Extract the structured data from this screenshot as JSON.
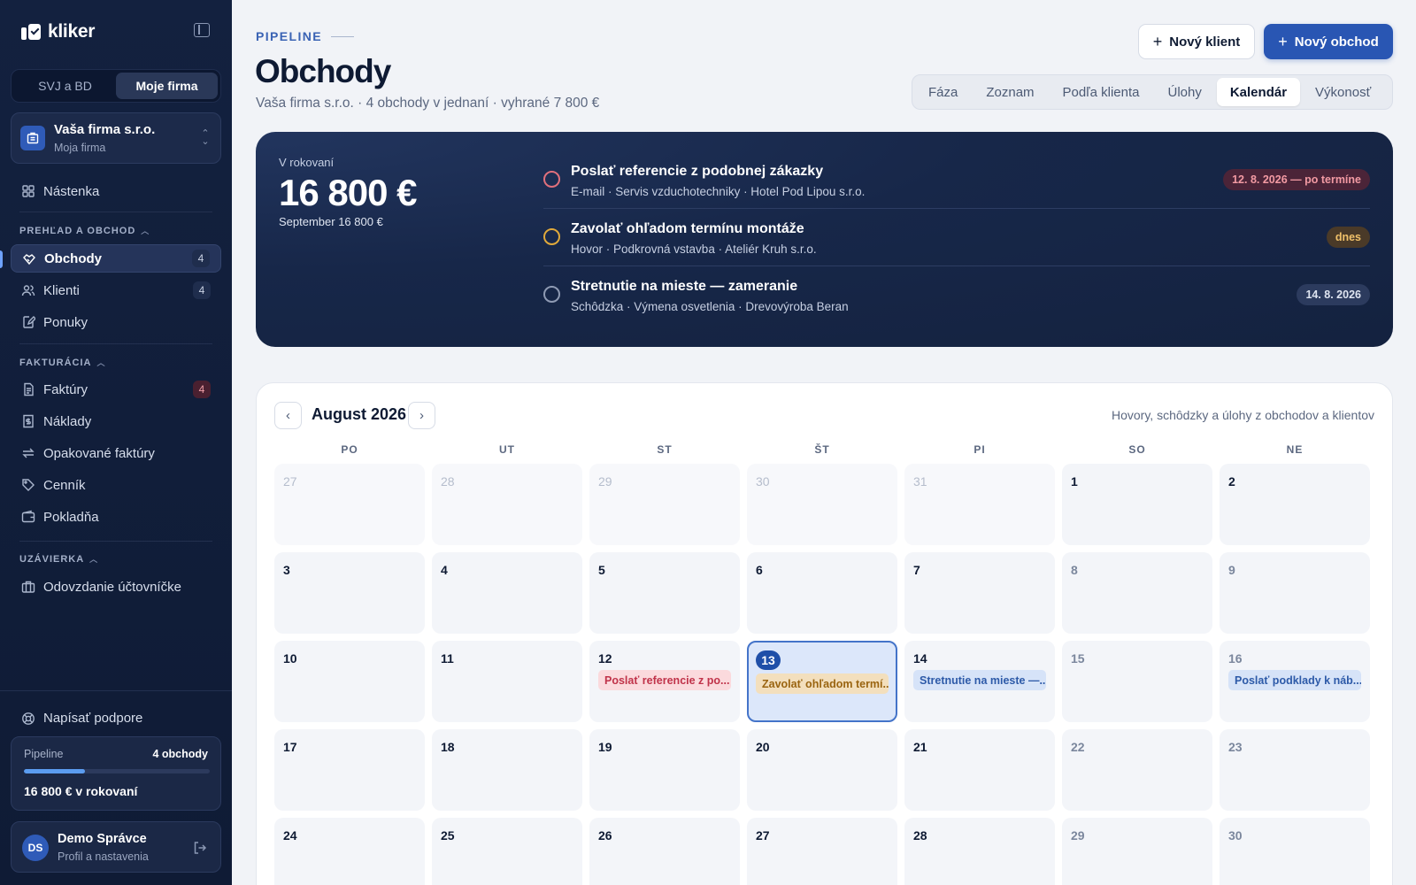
{
  "sidebar": {
    "brand": "kliker",
    "segment": [
      "SVJ a BD",
      "Moje firma"
    ],
    "org": {
      "name": "Vaša firma s.r.o.",
      "sub": "Moja firma"
    },
    "dashboard": "Nástenka",
    "sections": {
      "prehlad": "PREHĽAD A OBCHOD",
      "fakturacia": "FAKTURÁCIA",
      "uzavierka": "UZÁVIERKA"
    },
    "items": {
      "obchody": {
        "label": "Obchody",
        "badge": "4"
      },
      "klienti": {
        "label": "Klienti",
        "badge": "4"
      },
      "ponuky": {
        "label": "Ponuky"
      },
      "faktury": {
        "label": "Faktúry",
        "badge": "4"
      },
      "naklady": {
        "label": "Náklady"
      },
      "opakovane": {
        "label": "Opakované faktúry"
      },
      "cennik": {
        "label": "Cenník"
      },
      "pokladna": {
        "label": "Pokladňa"
      },
      "odovzdanie": {
        "label": "Odovzdanie účtovníčke"
      }
    },
    "support": "Napísať podpore",
    "pipeline": {
      "label": "Pipeline",
      "count": "4 obchody",
      "value": "16 800 € v rokovaní"
    },
    "user": {
      "initials": "DS",
      "name": "Demo Správce",
      "sub": "Profil a nastavenia"
    }
  },
  "header": {
    "eyebrow": "PIPELINE",
    "title": "Obchody",
    "subtitle": "Vaša firma s.r.o. · 4 obchody v jednaní · vyhrané 7 800 €",
    "new_client": "Nový klient",
    "new_deal": "Nový obchod",
    "tabs": [
      "Fáza",
      "Zoznam",
      "Podľa klienta",
      "Úlohy",
      "Kalendár",
      "Výkonosť"
    ]
  },
  "hero": {
    "label": "V rokovaní",
    "value": "16 800 €",
    "sub": "September 16 800 €",
    "tasks": [
      {
        "title": "Poslať referencie z podobnej zákazky",
        "sub": "E-mail · Servis vzduchotechniky · Hotel Pod Lipou s.r.o.",
        "pill": "12. 8. 2026 — po termíne"
      },
      {
        "title": "Zavolať ohľadom termínu montáže",
        "sub": "Hovor · Podkrovná vstavba · Ateliér Kruh s.r.o.",
        "pill": "dnes"
      },
      {
        "title": "Stretnutie na mieste — zameranie",
        "sub": "Schôdzka · Výmena osvetlenia · Drevovýroba Beran",
        "pill": "14. 8. 2026"
      }
    ]
  },
  "calendar": {
    "month": "August 2026",
    "hint": "Hovory, schôdzky a úlohy z obchodov a klientov",
    "weekdays": [
      "PO",
      "UT",
      "ST",
      "ŠT",
      "PI",
      "SO",
      "NE"
    ],
    "days": [
      "27",
      "28",
      "29",
      "30",
      "31",
      "1",
      "2",
      "3",
      "4",
      "5",
      "6",
      "7",
      "8",
      "9",
      "10",
      "11",
      "12",
      "13",
      "14",
      "15",
      "16",
      "17",
      "18",
      "19",
      "20",
      "21",
      "22",
      "23",
      "24",
      "25",
      "26",
      "27",
      "28",
      "29",
      "30"
    ],
    "events": {
      "d12": "Poslať referencie z po...",
      "d13": "Zavolať ohľadom termí...",
      "d14": "Stretnutie na mieste —...",
      "d16": "Poslať podklady k náb..."
    }
  },
  "colors": {
    "accent": "#2956b3",
    "overdue": "#e0707c",
    "today": "#e0a93b",
    "future": "#8e9ab3"
  }
}
